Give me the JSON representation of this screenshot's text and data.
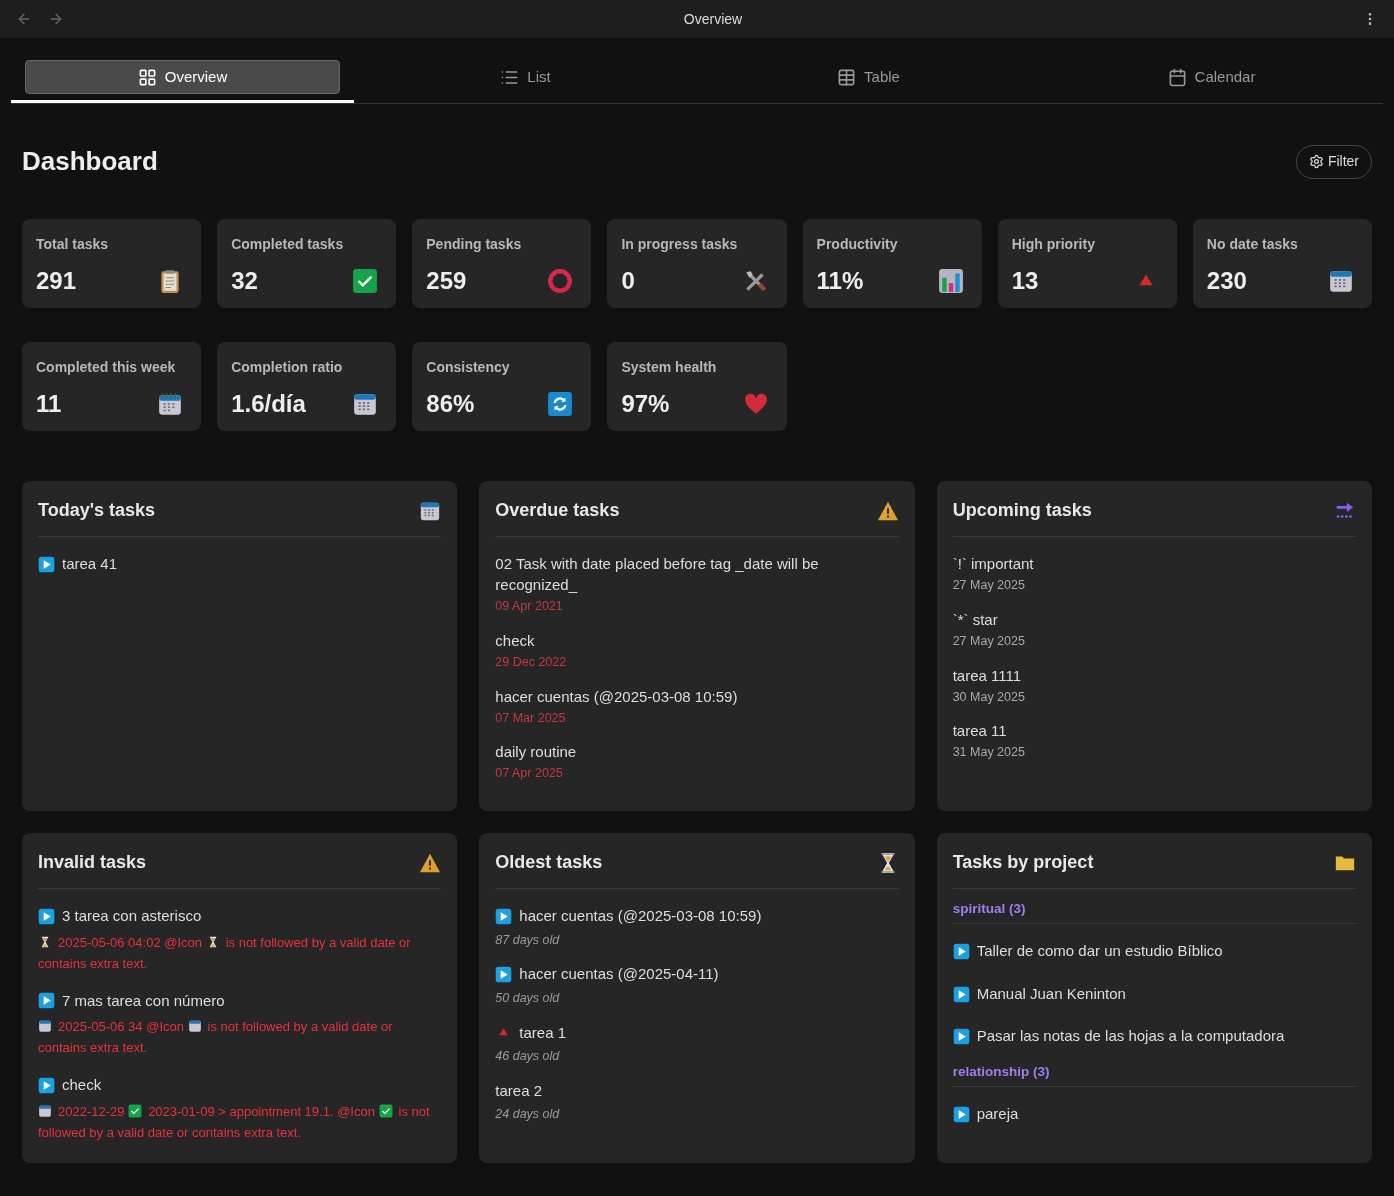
{
  "window": {
    "title": "Overview"
  },
  "tabs": [
    {
      "label": "Overview",
      "selected": true
    },
    {
      "label": "List",
      "selected": false
    },
    {
      "label": "Table",
      "selected": false
    },
    {
      "label": "Calendar",
      "selected": false
    }
  ],
  "heading": "Dashboard",
  "filter_button": "Filter",
  "stats": [
    {
      "label": "Total tasks",
      "value": "291"
    },
    {
      "label": "Completed tasks",
      "value": "32"
    },
    {
      "label": "Pending tasks",
      "value": "259"
    },
    {
      "label": "In progress tasks",
      "value": "0"
    },
    {
      "label": "Productivity",
      "value": "11%"
    },
    {
      "label": "High priority",
      "value": "13"
    },
    {
      "label": "No date tasks",
      "value": "230"
    },
    {
      "label": "Completed this week",
      "value": "11"
    },
    {
      "label": "Completion ratio",
      "value": "1.6/día"
    },
    {
      "label": "Consistency",
      "value": "86%"
    },
    {
      "label": "System health",
      "value": "97%"
    }
  ],
  "today": {
    "title": "Today's tasks",
    "tasks": [
      {
        "kind": "play",
        "name": "tarea 41"
      }
    ]
  },
  "overdue": {
    "title": "Overdue tasks",
    "tasks": [
      {
        "name": "02 Task with date placed before tag _date will be recognized_",
        "date": "09 Apr 2021"
      },
      {
        "name": "check",
        "date": "29 Dec 2022"
      },
      {
        "name": "hacer cuentas (@2025-03-08 10:59)",
        "date": "07 Mar 2025"
      },
      {
        "name": "daily routine",
        "date": "07 Apr 2025"
      }
    ]
  },
  "upcoming": {
    "title": "Upcoming tasks",
    "tasks": [
      {
        "name": "`!` important",
        "date": "27 May 2025"
      },
      {
        "name": "`*` star",
        "date": "27 May 2025"
      },
      {
        "name": "tarea 1111",
        "date": "30 May 2025"
      },
      {
        "name": "tarea 11",
        "date": "31 May 2025"
      }
    ]
  },
  "invalid": {
    "title": "Invalid tasks",
    "tasks": [
      {
        "kind": "play",
        "name": "3 tarea con asterisco",
        "error": [
          {
            "kind": "hourglass"
          },
          {
            "kind": "text",
            "text": "2025-05-06 04:02 @Icon"
          },
          {
            "kind": "hourglass"
          },
          {
            "kind": "text",
            "text": "is not followed by a valid date or"
          },
          {
            "kind": "text",
            "text": "contains extra text."
          }
        ]
      },
      {
        "kind": "play",
        "name": "7 mas tarea con número",
        "error": [
          {
            "kind": "calendar"
          },
          {
            "kind": "text",
            "text": "2025-05-06 34 @Icon"
          },
          {
            "kind": "calendar"
          },
          {
            "kind": "text",
            "text": "is not followed by a valid date or"
          },
          {
            "kind": "text",
            "text": "contains extra text."
          }
        ]
      },
      {
        "kind": "play",
        "name": "check",
        "error": [
          {
            "kind": "calendar"
          },
          {
            "kind": "text",
            "text": "2022-12-29"
          },
          {
            "kind": "check"
          },
          {
            "kind": "text",
            "text": "2023-01-09 > appointment 19.1. @Icon"
          },
          {
            "kind": "check"
          },
          {
            "kind": "text",
            "text": "is not"
          },
          {
            "kind": "text",
            "text": "followed by a valid date or contains extra text."
          }
        ]
      }
    ]
  },
  "oldest": {
    "title": "Oldest tasks",
    "tasks": [
      {
        "kind": "play",
        "name": "hacer cuentas (@2025-03-08 10:59)",
        "age": "87 days old"
      },
      {
        "kind": "play",
        "name": "hacer cuentas (@2025-04-11)",
        "age": "50 days old"
      },
      {
        "kind": "priority",
        "name": "tarea 1",
        "age": "46 days old"
      },
      {
        "kind": "plain",
        "name": "tarea 2",
        "age": "24 days old"
      }
    ]
  },
  "projects": {
    "title": "Tasks by project",
    "groups": [
      {
        "name": "spiritual (3)",
        "tasks": [
          {
            "kind": "play",
            "name": "Taller de como dar un estudio Bíblico"
          },
          {
            "kind": "play",
            "name": "Manual Juan Keninton"
          },
          {
            "kind": "play",
            "name": "Pasar las notas de las hojas a la computadora"
          }
        ]
      },
      {
        "name": "relationship (3)",
        "tasks": [
          {
            "kind": "play",
            "name": "pareja"
          }
        ]
      }
    ]
  }
}
